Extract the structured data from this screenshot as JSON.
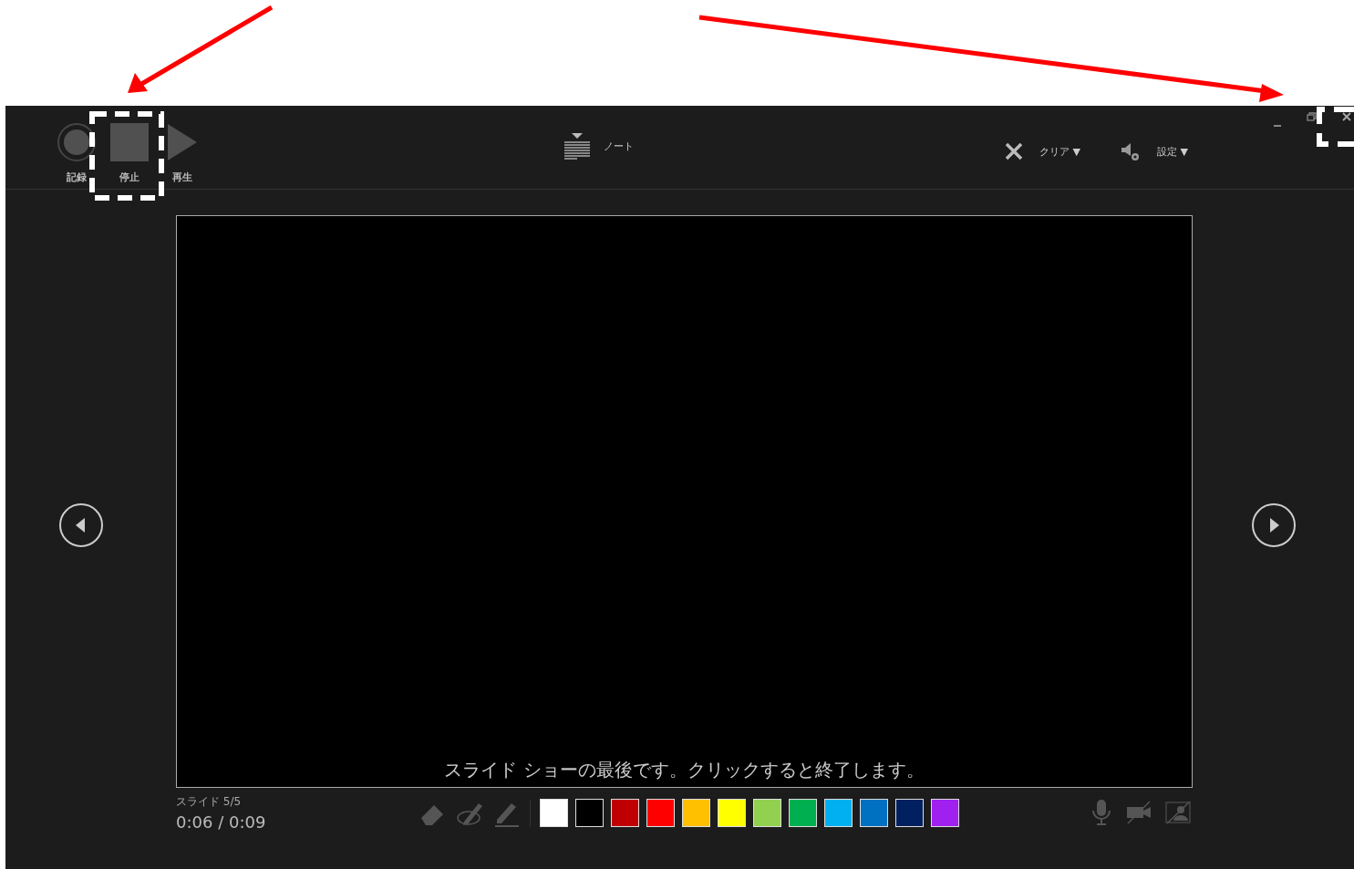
{
  "toolbar": {
    "record_buttons": [
      {
        "kind": "record",
        "label": "記録"
      },
      {
        "kind": "stop",
        "label": "停止"
      },
      {
        "kind": "play",
        "label": "再生"
      }
    ],
    "notes": {
      "label": "ノート"
    },
    "clear": {
      "label": "クリア",
      "caret": "▼"
    },
    "settings": {
      "label": "設定",
      "caret": "▼"
    }
  },
  "slide": {
    "message": "スライド ショーの最後です。クリックすると終了します。"
  },
  "footer": {
    "slide_counter": "スライド 5/5",
    "time": "0:06 / 0:09",
    "colors": [
      {
        "color": "#ffffff"
      },
      {
        "color": "#000000"
      },
      {
        "color": "#c00000"
      },
      {
        "color": "#ff0000"
      },
      {
        "color": "#ffc000"
      },
      {
        "color": "#ffff00"
      },
      {
        "color": "#92d050"
      },
      {
        "color": "#00b050"
      },
      {
        "color": "#00b0f0"
      },
      {
        "color": "#0070c0"
      },
      {
        "color": "#002060"
      },
      {
        "color": "#a020f0"
      }
    ]
  }
}
